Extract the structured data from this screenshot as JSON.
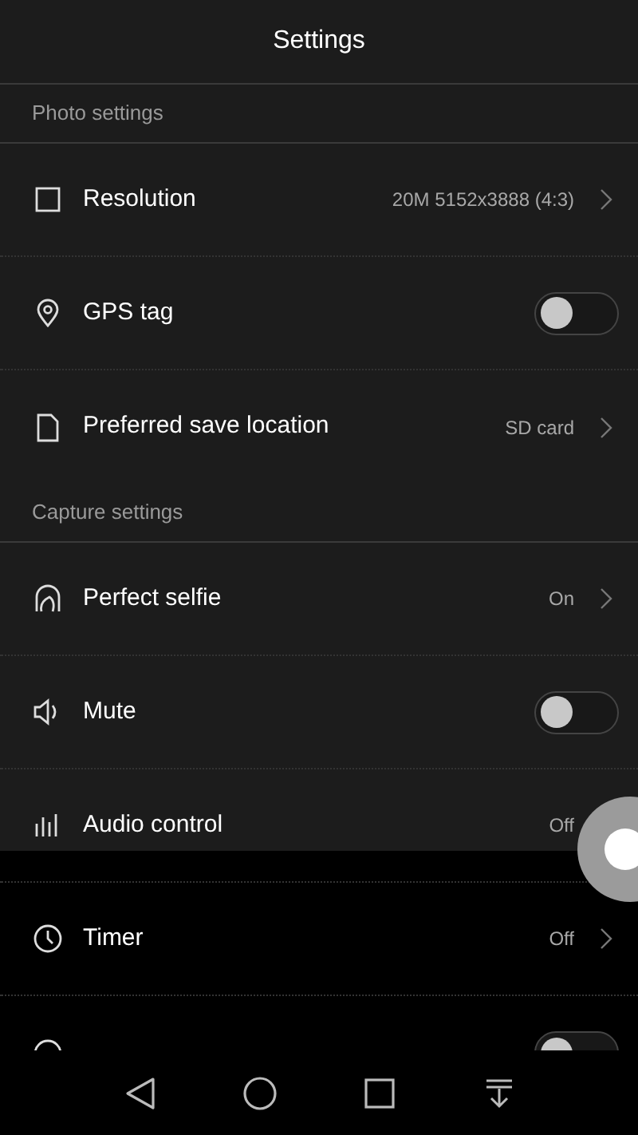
{
  "title": "Settings",
  "sections": [
    {
      "heading": "Photo settings",
      "items": [
        {
          "kind": "link",
          "label": "Resolution",
          "value": "20M 5152x3888 (4:3)"
        },
        {
          "kind": "toggle",
          "label": "GPS tag",
          "on": false
        },
        {
          "kind": "link",
          "label": "Preferred save location",
          "value": "SD card"
        }
      ]
    },
    {
      "heading": "Capture settings",
      "items": [
        {
          "kind": "link",
          "label": "Perfect selfie",
          "value": "On"
        },
        {
          "kind": "toggle",
          "label": "Mute",
          "on": false
        },
        {
          "kind": "link",
          "label": "Audio control",
          "value": "Off",
          "chevron": false
        },
        {
          "kind": "link",
          "label": "Timer",
          "value": "Off"
        },
        {
          "kind": "toggle",
          "on": false
        }
      ]
    }
  ]
}
